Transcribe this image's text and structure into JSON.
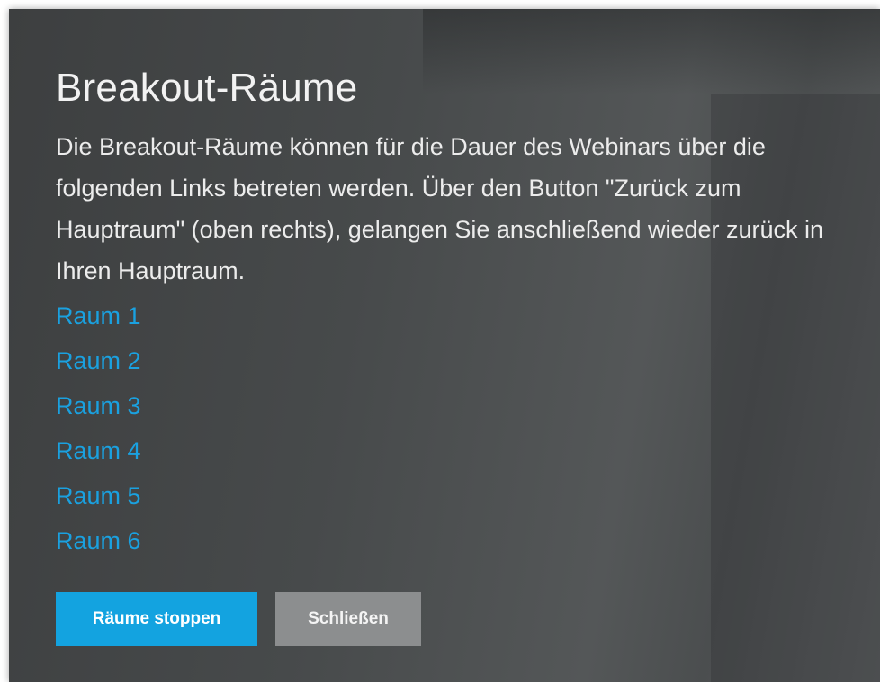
{
  "dialog": {
    "title": "Breakout-Räume",
    "description": "Die Breakout-Räume können für die Dauer des Webinars über die folgenden Links betreten werden. Über den Button \"Zurück zum Hauptraum\" (oben rechts), gelangen Sie anschließend wieder zurück in Ihren Hauptraum.",
    "rooms": [
      {
        "label": "Raum 1"
      },
      {
        "label": "Raum 2"
      },
      {
        "label": "Raum 3"
      },
      {
        "label": "Raum 4"
      },
      {
        "label": "Raum 5"
      },
      {
        "label": "Raum 6"
      }
    ],
    "buttons": {
      "stop_label": "Räume stoppen",
      "close_label": "Schließen"
    }
  },
  "colors": {
    "link": "#1aa1e0",
    "primary_button": "#13a3e0",
    "secondary_button": "#8c8e8f",
    "dialog_background": "#474a4b"
  }
}
